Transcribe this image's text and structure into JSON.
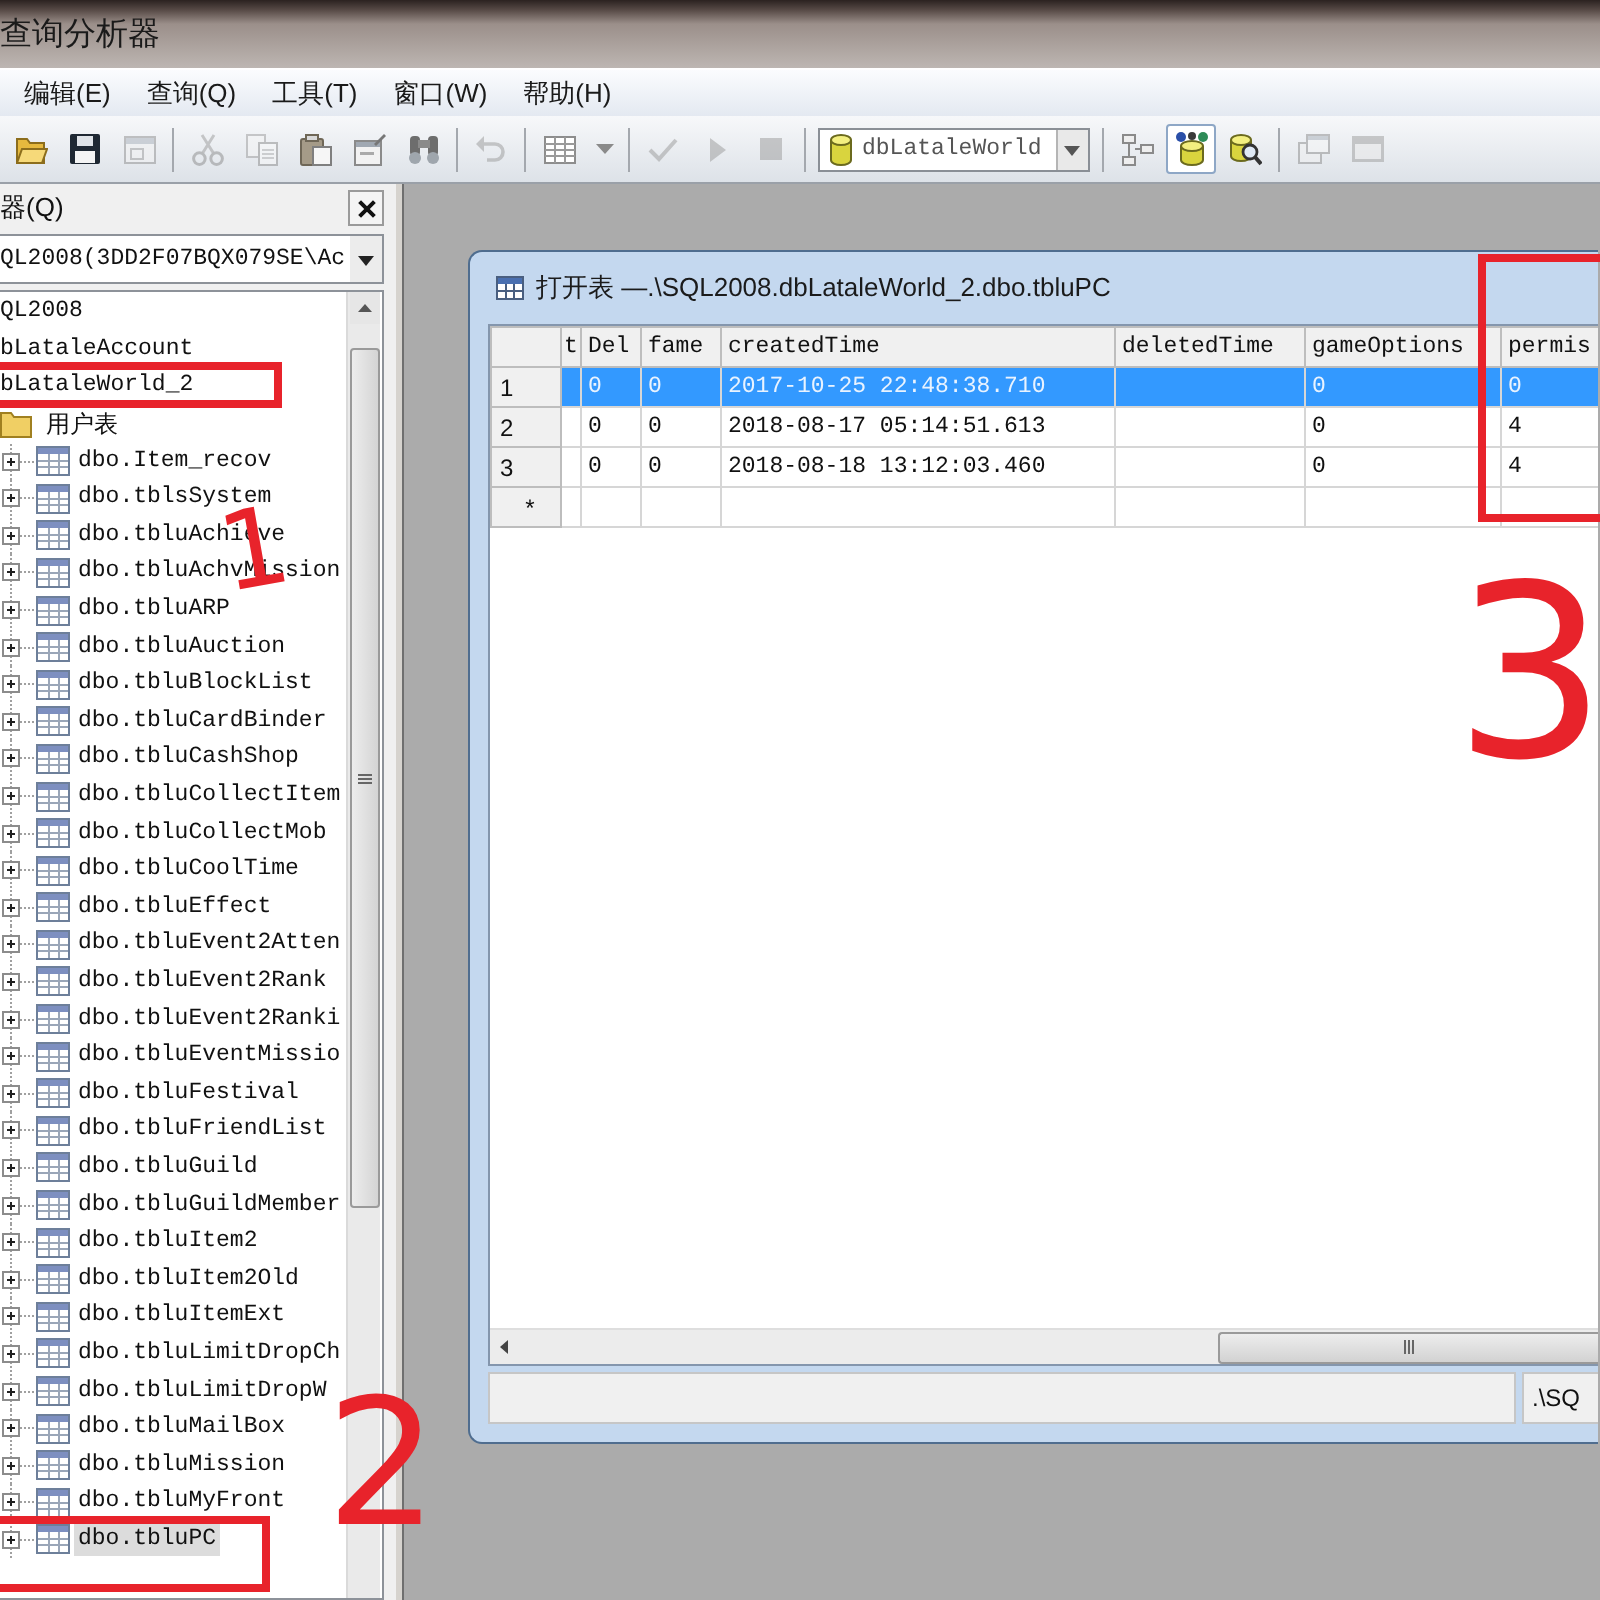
{
  "window": {
    "title": "查询分析器"
  },
  "menu": [
    {
      "label": "编辑(E)"
    },
    {
      "label": "查询(Q)"
    },
    {
      "label": "工具(T)"
    },
    {
      "label": "窗口(W)"
    },
    {
      "label": "帮助(H)"
    }
  ],
  "toolbar": {
    "buttons": [
      {
        "pressed": false,
        "disabled": false
      },
      {
        "pressed": false,
        "disabled": false
      },
      {
        "pressed": false,
        "disabled": true
      },
      {
        "pressed": false,
        "disabled": true
      },
      {
        "pressed": false,
        "disabled": true
      },
      {
        "pressed": false,
        "disabled": false
      },
      {
        "pressed": false,
        "disabled": false
      },
      {
        "pressed": false,
        "disabled": false
      },
      {
        "pressed": false,
        "disabled": true
      },
      {
        "pressed": false,
        "disabled": false
      },
      {
        "pressed": false,
        "disabled": false
      },
      {
        "pressed": false,
        "disabled": true
      },
      {
        "pressed": false,
        "disabled": true
      },
      {
        "pressed": false,
        "disabled": true
      },
      {
        "pressed": false,
        "disabled": false
      },
      {
        "pressed": true,
        "disabled": false
      },
      {
        "pressed": false,
        "disabled": false
      },
      {
        "pressed": false,
        "disabled": true
      },
      {
        "pressed": false,
        "disabled": true
      }
    ],
    "database": "dbLataleWorld"
  },
  "object_browser": {
    "title": "器(Q)",
    "server": "QL2008(3DD2F07BQX079SE\\Ac",
    "tree": [
      {
        "label": "QL2008",
        "selected": false,
        "children": [
          {
            "label": "bLataleAccount",
            "selected": false
          },
          {
            "label": "bLataleWorld_2",
            "selected": false,
            "children": [
              {
                "label": "用户表",
                "selected": false,
                "children": [
                  {
                    "label": "dbo.Item_recov",
                    "selected": false,
                    "expanded": false
                  },
                  {
                    "label": "dbo.tblsSystem",
                    "selected": false,
                    "expanded": false
                  },
                  {
                    "label": "dbo.tbluAchieve",
                    "selected": false,
                    "expanded": false
                  },
                  {
                    "label": "dbo.tbluAchvMission",
                    "selected": false,
                    "expanded": false
                  },
                  {
                    "label": "dbo.tbluARP",
                    "selected": false,
                    "expanded": false
                  },
                  {
                    "label": "dbo.tbluAuction",
                    "selected": false,
                    "expanded": false
                  },
                  {
                    "label": "dbo.tbluBlockList",
                    "selected": false,
                    "expanded": false
                  },
                  {
                    "label": "dbo.tbluCardBinder",
                    "selected": false,
                    "expanded": false
                  },
                  {
                    "label": "dbo.tbluCashShop",
                    "selected": false,
                    "expanded": false
                  },
                  {
                    "label": "dbo.tbluCollectItem",
                    "selected": false,
                    "expanded": false
                  },
                  {
                    "label": "dbo.tbluCollectMob",
                    "selected": false,
                    "expanded": false
                  },
                  {
                    "label": "dbo.tbluCoolTime",
                    "selected": false,
                    "expanded": false
                  },
                  {
                    "label": "dbo.tbluEffect",
                    "selected": false,
                    "expanded": false
                  },
                  {
                    "label": "dbo.tbluEvent2Atten",
                    "selected": false,
                    "expanded": false
                  },
                  {
                    "label": "dbo.tbluEvent2Rank",
                    "selected": false,
                    "expanded": false
                  },
                  {
                    "label": "dbo.tbluEvent2Ranki",
                    "selected": false,
                    "expanded": false
                  },
                  {
                    "label": "dbo.tbluEventMissio",
                    "selected": false,
                    "expanded": false
                  },
                  {
                    "label": "dbo.tbluFestival",
                    "selected": false,
                    "expanded": false
                  },
                  {
                    "label": "dbo.tbluFriendList",
                    "selected": false,
                    "expanded": false
                  },
                  {
                    "label": "dbo.tbluGuild",
                    "selected": false,
                    "expanded": false
                  },
                  {
                    "label": "dbo.tbluGuildMember",
                    "selected": false,
                    "expanded": false
                  },
                  {
                    "label": "dbo.tbluItem2",
                    "selected": false,
                    "expanded": false
                  },
                  {
                    "label": "dbo.tbluItem2Old",
                    "selected": false,
                    "expanded": false
                  },
                  {
                    "label": "dbo.tbluItemExt",
                    "selected": false,
                    "expanded": false
                  },
                  {
                    "label": "dbo.tbluLimitDropCh",
                    "selected": false,
                    "expanded": false
                  },
                  {
                    "label": "dbo.tbluLimitDropW",
                    "selected": false,
                    "expanded": false
                  },
                  {
                    "label": "dbo.tbluMailBox",
                    "selected": false,
                    "expanded": false
                  },
                  {
                    "label": "dbo.tbluMission",
                    "selected": false,
                    "expanded": false
                  },
                  {
                    "label": "dbo.tbluMyFront",
                    "selected": false,
                    "expanded": false
                  },
                  {
                    "label": "dbo.tbluPC",
                    "selected": true,
                    "expanded": false
                  }
                ]
              }
            ]
          }
        ]
      }
    ]
  },
  "table_window": {
    "title": "打开表 —.\\SQL2008.dbLataleWorld_2.dbo.tbluPC",
    "columns": [
      "t",
      "Del",
      "fame",
      "createdTime",
      "deletedTime",
      "gameOptions",
      "permis"
    ],
    "rows": [
      {
        "header": "1",
        "selected": true,
        "cells": [
          null,
          "0",
          "0",
          "2017-10-25 22:48:38.710",
          null,
          "0",
          "0"
        ]
      },
      {
        "header": "2",
        "selected": false,
        "cells": [
          null,
          "0",
          "0",
          "2018-08-17 05:14:51.613",
          null,
          "0",
          "4"
        ]
      },
      {
        "header": "3",
        "selected": false,
        "cells": [
          null,
          "0",
          "0",
          "2018-08-18 13:12:03.460",
          null,
          "0",
          "4"
        ]
      }
    ],
    "new_row": "*",
    "status": ".\\SQ"
  },
  "annotations": [
    {
      "kind": "box"
    },
    {
      "kind": "number",
      "label": "1"
    },
    {
      "kind": "box"
    },
    {
      "kind": "number",
      "label": "3"
    },
    {
      "kind": "number",
      "label": "2"
    },
    {
      "kind": "box"
    }
  ]
}
